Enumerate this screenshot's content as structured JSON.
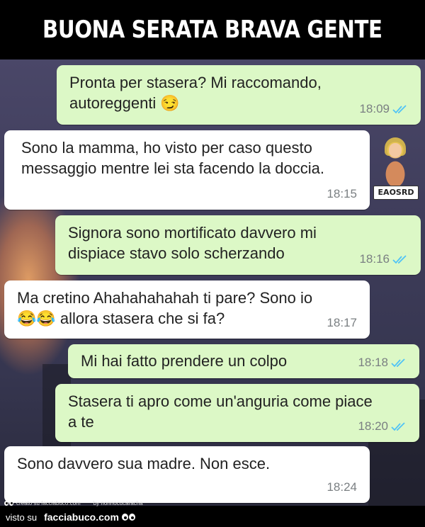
{
  "header": {
    "title": "BUONA SERATA BRAVA GENTE"
  },
  "messages": [
    {
      "direction": "out",
      "text": "Pronta per stasera? Mi raccomando, autoreggenti 😏",
      "time": "18:09",
      "read": true
    },
    {
      "direction": "in",
      "text": "Sono la mamma, ho visto per caso questo messaggio mentre lei sta facendo la doccia.",
      "time": "18:15"
    },
    {
      "direction": "out",
      "text": "Signora sono mortificato davvero mi dispiace stavo solo scherzando",
      "time": "18:16",
      "read": true
    },
    {
      "direction": "in",
      "text": "Ma cretino Ahahahahahah ti pare? Sono io 😂😂 allora stasera che si fa?",
      "time": "18:17"
    },
    {
      "direction": "out",
      "text": "Mi hai fatto prendere un colpo",
      "time": "18:18",
      "read": true
    },
    {
      "direction": "out",
      "text": "Stasera ti apro come un'anguria come piace a te",
      "time": "18:20",
      "read": true
    },
    {
      "direction": "in",
      "text": "Sono davvero sua madre. Non esce.",
      "time": "18:24"
    }
  ],
  "sticker": {
    "caption": "EAOSRD"
  },
  "footer": {
    "created_on": "creato su facciabuco.com",
    "by": "by nonnocucaracha",
    "seen_on": "visto su",
    "brand": "facciabuco.com"
  },
  "colors": {
    "outgoing_bubble": "#dcf8c6",
    "incoming_bubble": "#ffffff",
    "read_check": "#4fc3f7",
    "header_bg": "#000000"
  }
}
